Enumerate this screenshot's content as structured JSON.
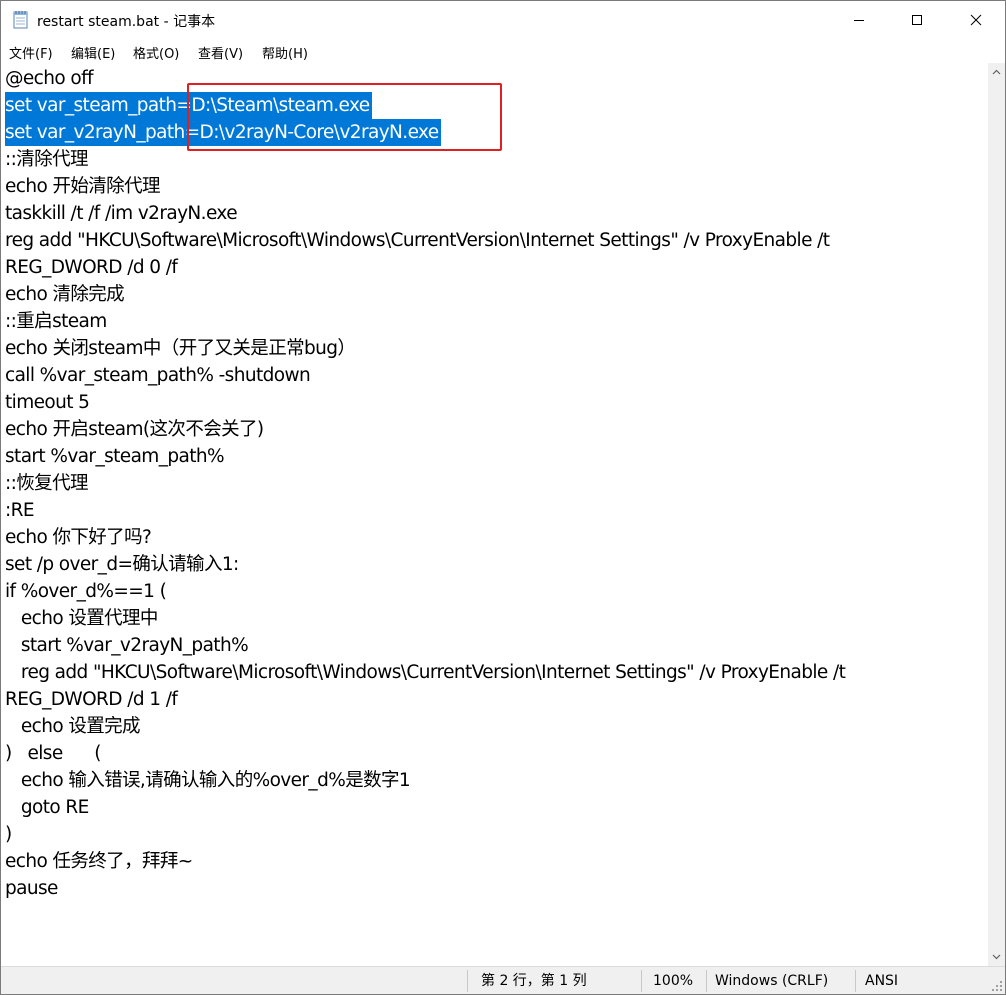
{
  "window": {
    "title": "restart steam.bat - 记事本"
  },
  "menu": {
    "items": [
      {
        "label": "文件(F)"
      },
      {
        "label": "编辑(E)"
      },
      {
        "label": "格式(O)"
      },
      {
        "label": "查看(V)"
      },
      {
        "label": "帮助(H)"
      }
    ]
  },
  "editor": {
    "lines": [
      "@echo off",
      "set var_steam_path=D:\\Steam\\steam.exe",
      "set var_v2rayN_path=D:\\v2rayN-Core\\v2rayN.exe",
      "::清除代理",
      "echo 开始清除代理",
      "taskkill /t /f /im v2rayN.exe",
      "reg add \"HKCU\\Software\\Microsoft\\Windows\\CurrentVersion\\Internet Settings\" /v ProxyEnable /t",
      "REG_DWORD /d 0 /f",
      "echo 清除完成",
      "::重启steam",
      "echo 关闭steam中（开了又关是正常bug）",
      "call %var_steam_path% -shutdown",
      "timeout 5",
      "echo 开启steam(这次不会关了)",
      "start %var_steam_path%",
      "::恢复代理",
      ":RE",
      "echo 你下好了吗?",
      "set /p over_d=确认请输入1:",
      "if %over_d%==1 (",
      "   echo 设置代理中",
      "   start %var_v2rayN_path%",
      "   reg add \"HKCU\\Software\\Microsoft\\Windows\\CurrentVersion\\Internet Settings\" /v ProxyEnable /t",
      "REG_DWORD /d 1 /f",
      "   echo 设置完成",
      ")   else      (",
      "   echo 输入错误,请确认输入的%over_d%是数字1",
      "   goto RE",
      ")",
      "echo 任务终了，拜拜~",
      "pause"
    ],
    "selected_lines": [
      1,
      2
    ]
  },
  "statusbar": {
    "position": "第 2 行，第 1 列",
    "zoom": "100%",
    "line_ending": "Windows (CRLF)",
    "encoding": "ANSI"
  },
  "colors": {
    "selection": "#0078d7",
    "highlight_box": "#e02020"
  }
}
